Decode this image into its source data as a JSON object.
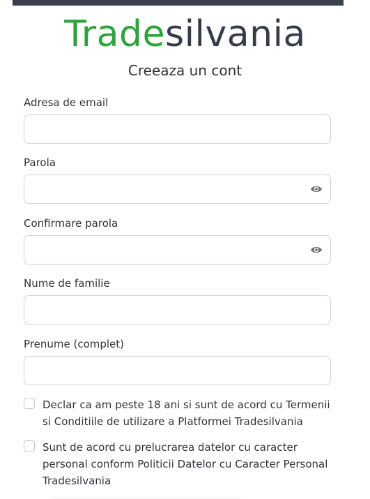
{
  "brand": {
    "part1": "Trade",
    "part2": "silvania",
    "color_primary": "#2ea23c",
    "color_secondary": "#353b48"
  },
  "page": {
    "subtitle": "Creeaza un cont"
  },
  "form": {
    "email": {
      "label": "Adresa de email",
      "value": "",
      "placeholder": ""
    },
    "password": {
      "label": "Parola",
      "value": "",
      "placeholder": "",
      "toggle_icon": "eye-icon"
    },
    "confirm_password": {
      "label": "Confirmare parola",
      "value": "",
      "placeholder": "",
      "toggle_icon": "eye-icon"
    },
    "last_name": {
      "label": "Nume de familie",
      "value": "",
      "placeholder": ""
    },
    "first_name": {
      "label": "Prenume (complet)",
      "value": "",
      "placeholder": ""
    },
    "consents": [
      {
        "text": "Declar ca am peste 18 ani si sunt de acord cu Termenii si Conditiile de utilizare a Platformei Tradesilvania",
        "checked": false
      },
      {
        "text": "Sunt de acord cu prelucrarea datelor cu caracter personal conform Politicii Datelor cu Caracter Personal Tradesilvania",
        "checked": false
      }
    ]
  }
}
